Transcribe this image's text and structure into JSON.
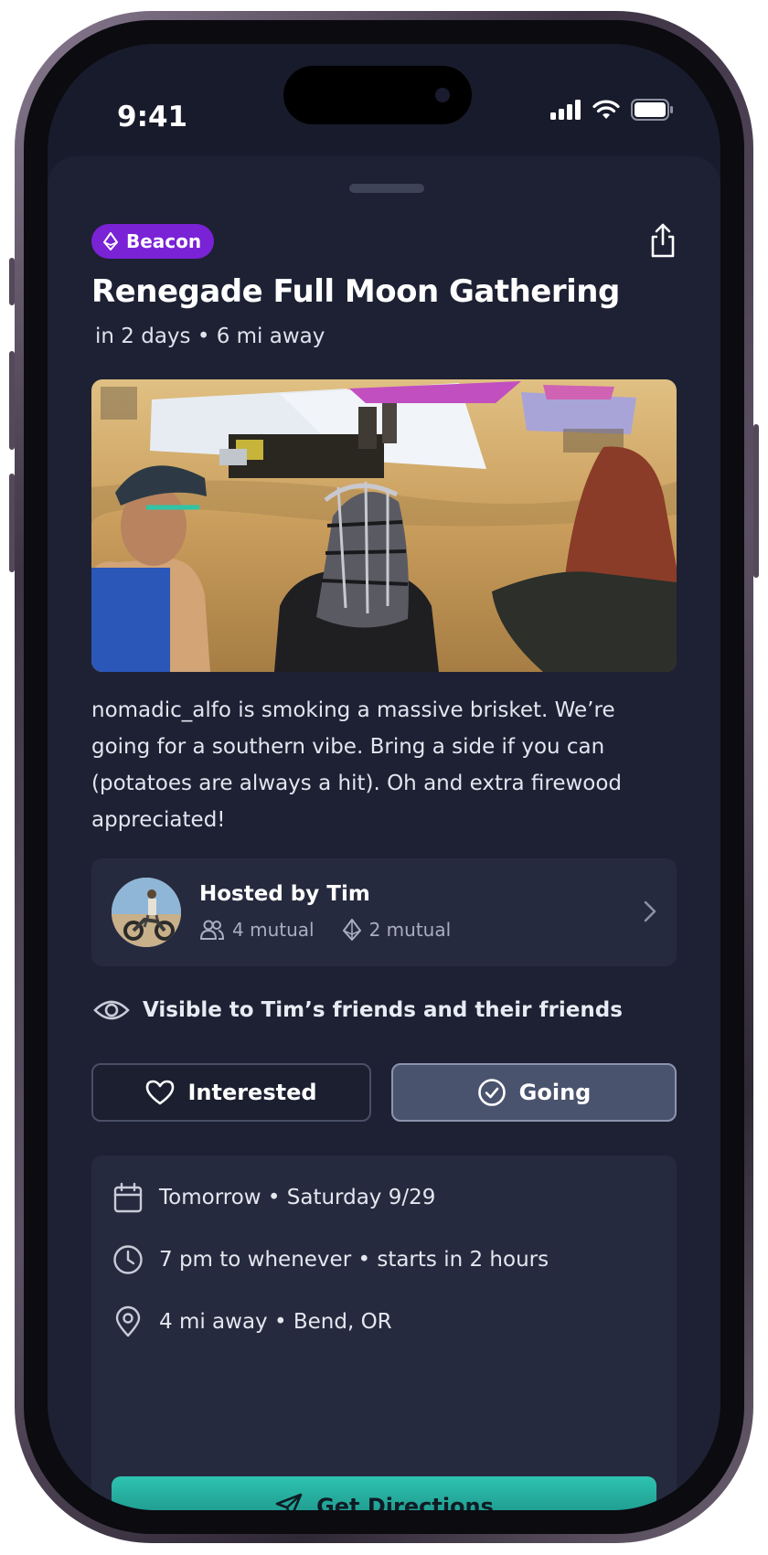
{
  "status_bar": {
    "time": "9:41"
  },
  "event": {
    "badge": "Beacon",
    "title": "Renegade Full Moon Gathering",
    "subtitle": "in 2 days • 6 mi away",
    "description": "nomadic_alfo is smoking a massive brisket. We’re going for a southern vibe. Bring a side if you can (potatoes are always a hit). Oh and extra firewood appreciated!"
  },
  "host": {
    "name": "Hosted by Tim",
    "mutual_friends": "4 mutual",
    "mutual_beacons": "2 mutual"
  },
  "visibility": "Visible to Tim’s friends and their friends",
  "actions": {
    "interested": "Interested",
    "going": "Going"
  },
  "details": {
    "date": "Tomorrow • Saturday 9/29",
    "time": "7 pm to whenever • starts in 2 hours",
    "location": "4 mi away • Bend, OR"
  },
  "directions_label": "Get Directions",
  "colors": {
    "accent": "#7a22d6",
    "directions": "#2ec4b1",
    "sheet": "#1d2133"
  },
  "icons": [
    "beacon-icon",
    "share-icon",
    "people-icon",
    "chevron-right-icon",
    "eye-icon",
    "heart-icon",
    "check-circle-icon",
    "calendar-icon",
    "clock-icon",
    "location-pin-icon",
    "navigation-icon"
  ]
}
